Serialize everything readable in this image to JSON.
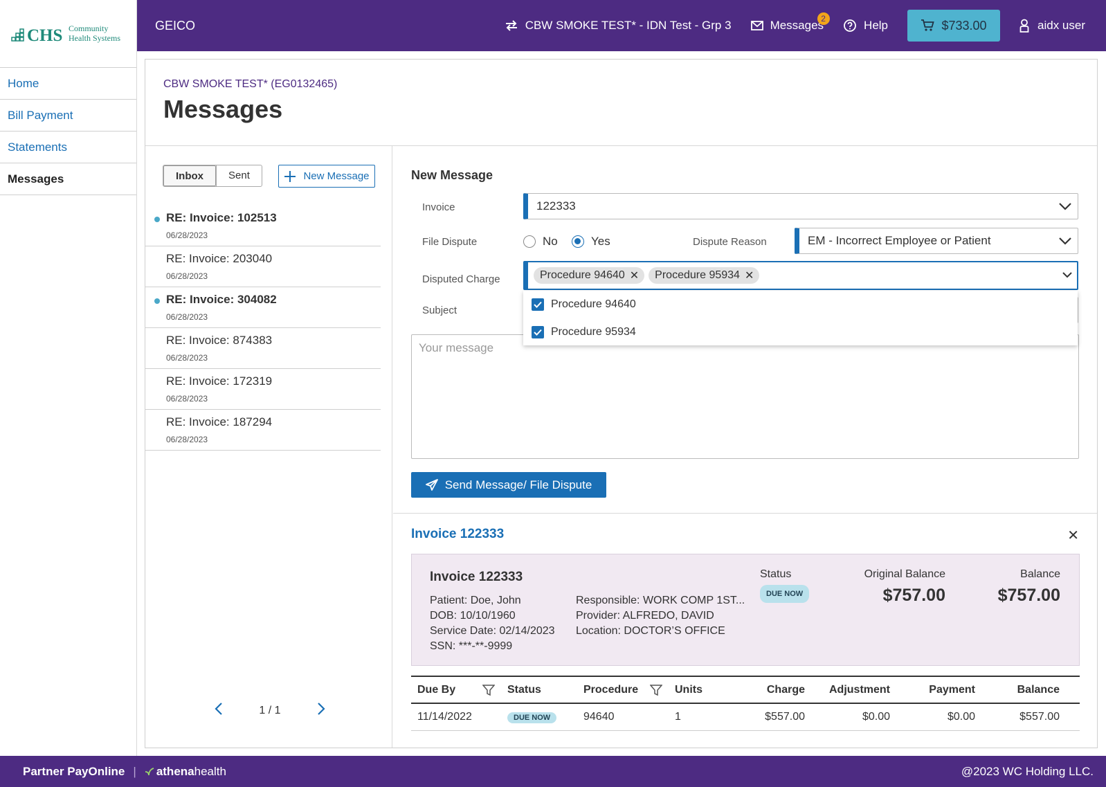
{
  "sidebar": {
    "logo_text": "CHS",
    "logo_sub1": "Community",
    "logo_sub2": "Health Systems",
    "items": [
      {
        "label": "Home"
      },
      {
        "label": "Bill Payment"
      },
      {
        "label": "Statements"
      },
      {
        "label": "Messages"
      }
    ]
  },
  "topbar": {
    "brand": "GEICO",
    "account_switch": "CBW SMOKE TEST* - IDN Test - Grp 3",
    "messages_label": "Messages",
    "messages_badge": "2",
    "help_label": "Help",
    "cart_total": "$733.00",
    "user": "aidx user"
  },
  "header": {
    "account": "CBW SMOKE TEST* (EG0132465)",
    "title": "Messages"
  },
  "inbox": {
    "tab_inbox": "Inbox",
    "tab_sent": "Sent",
    "new_message": "New Message",
    "messages": [
      {
        "title": "RE: Invoice: 102513",
        "date": "06/28/2023",
        "unread": true
      },
      {
        "title": "RE: Invoice: 203040",
        "date": "06/28/2023",
        "unread": false
      },
      {
        "title": "RE: Invoice: 304082",
        "date": "06/28/2023",
        "unread": true
      },
      {
        "title": "RE: Invoice: 874383",
        "date": "06/28/2023",
        "unread": false
      },
      {
        "title": "RE: Invoice: 172319",
        "date": "06/28/2023",
        "unread": false
      },
      {
        "title": "RE: Invoice: 187294",
        "date": "06/28/2023",
        "unread": false
      }
    ],
    "pager": "1 / 1"
  },
  "form": {
    "title": "New Message",
    "invoice_label": "Invoice",
    "invoice_value": "122333",
    "dispute_label": "File Dispute",
    "radio_no": "No",
    "radio_yes": "Yes",
    "reason_label": "Dispute Reason",
    "reason_value": "EM - Incorrect Employee or Patient",
    "charge_label": "Disputed Charge",
    "chips": [
      "Procedure  94640",
      "Procedure 95934"
    ],
    "options": [
      "Procedure 94640",
      "Procedure 95934"
    ],
    "subject_label": "Subject",
    "message_placeholder": "Your message",
    "send_label": "Send Message/ File Dispute"
  },
  "invoice": {
    "panel_title": "Invoice 122333",
    "card_title": "Invoice 122333",
    "patient": "Patient: Doe, John",
    "dob": "DOB: 10/10/1960",
    "service_date": "Service Date: 02/14/2023",
    "ssn": "SSN: ***-**-9999",
    "responsible": "Responsible: WORK COMP 1ST...",
    "provider": "Provider: ALFREDO, DAVID",
    "location": "Location: DOCTOR’S OFFICE",
    "status_label": "Status",
    "status_value": "DUE NOW",
    "orig_label": "Original Balance",
    "orig_value": "$757.00",
    "bal_label": "Balance",
    "bal_value": "$757.00",
    "table_headers": {
      "due_by": "Due By",
      "status": "Status",
      "procedure": "Procedure",
      "units": "Units",
      "charge": "Charge",
      "adjustment": "Adjustment",
      "payment": "Payment",
      "balance": "Balance"
    },
    "row": {
      "due_by": "11/14/2022",
      "status": "DUE NOW",
      "procedure": "94640",
      "units": "1",
      "charge": "$557.00",
      "adjustment": "$0.00",
      "payment": "$0.00",
      "balance": "$557.00"
    }
  },
  "footer": {
    "product": "Partner PayOnline",
    "partner": "athenahealth",
    "partner_bold": "athena",
    "partner_rest": "health",
    "copyright": "@2023 WC Holding LLC."
  },
  "colors": {
    "brand_purple": "#4d2b82",
    "link_blue": "#1a6fb5",
    "cart_teal": "#4fb3cf",
    "badge_orange": "#f2a51a"
  }
}
